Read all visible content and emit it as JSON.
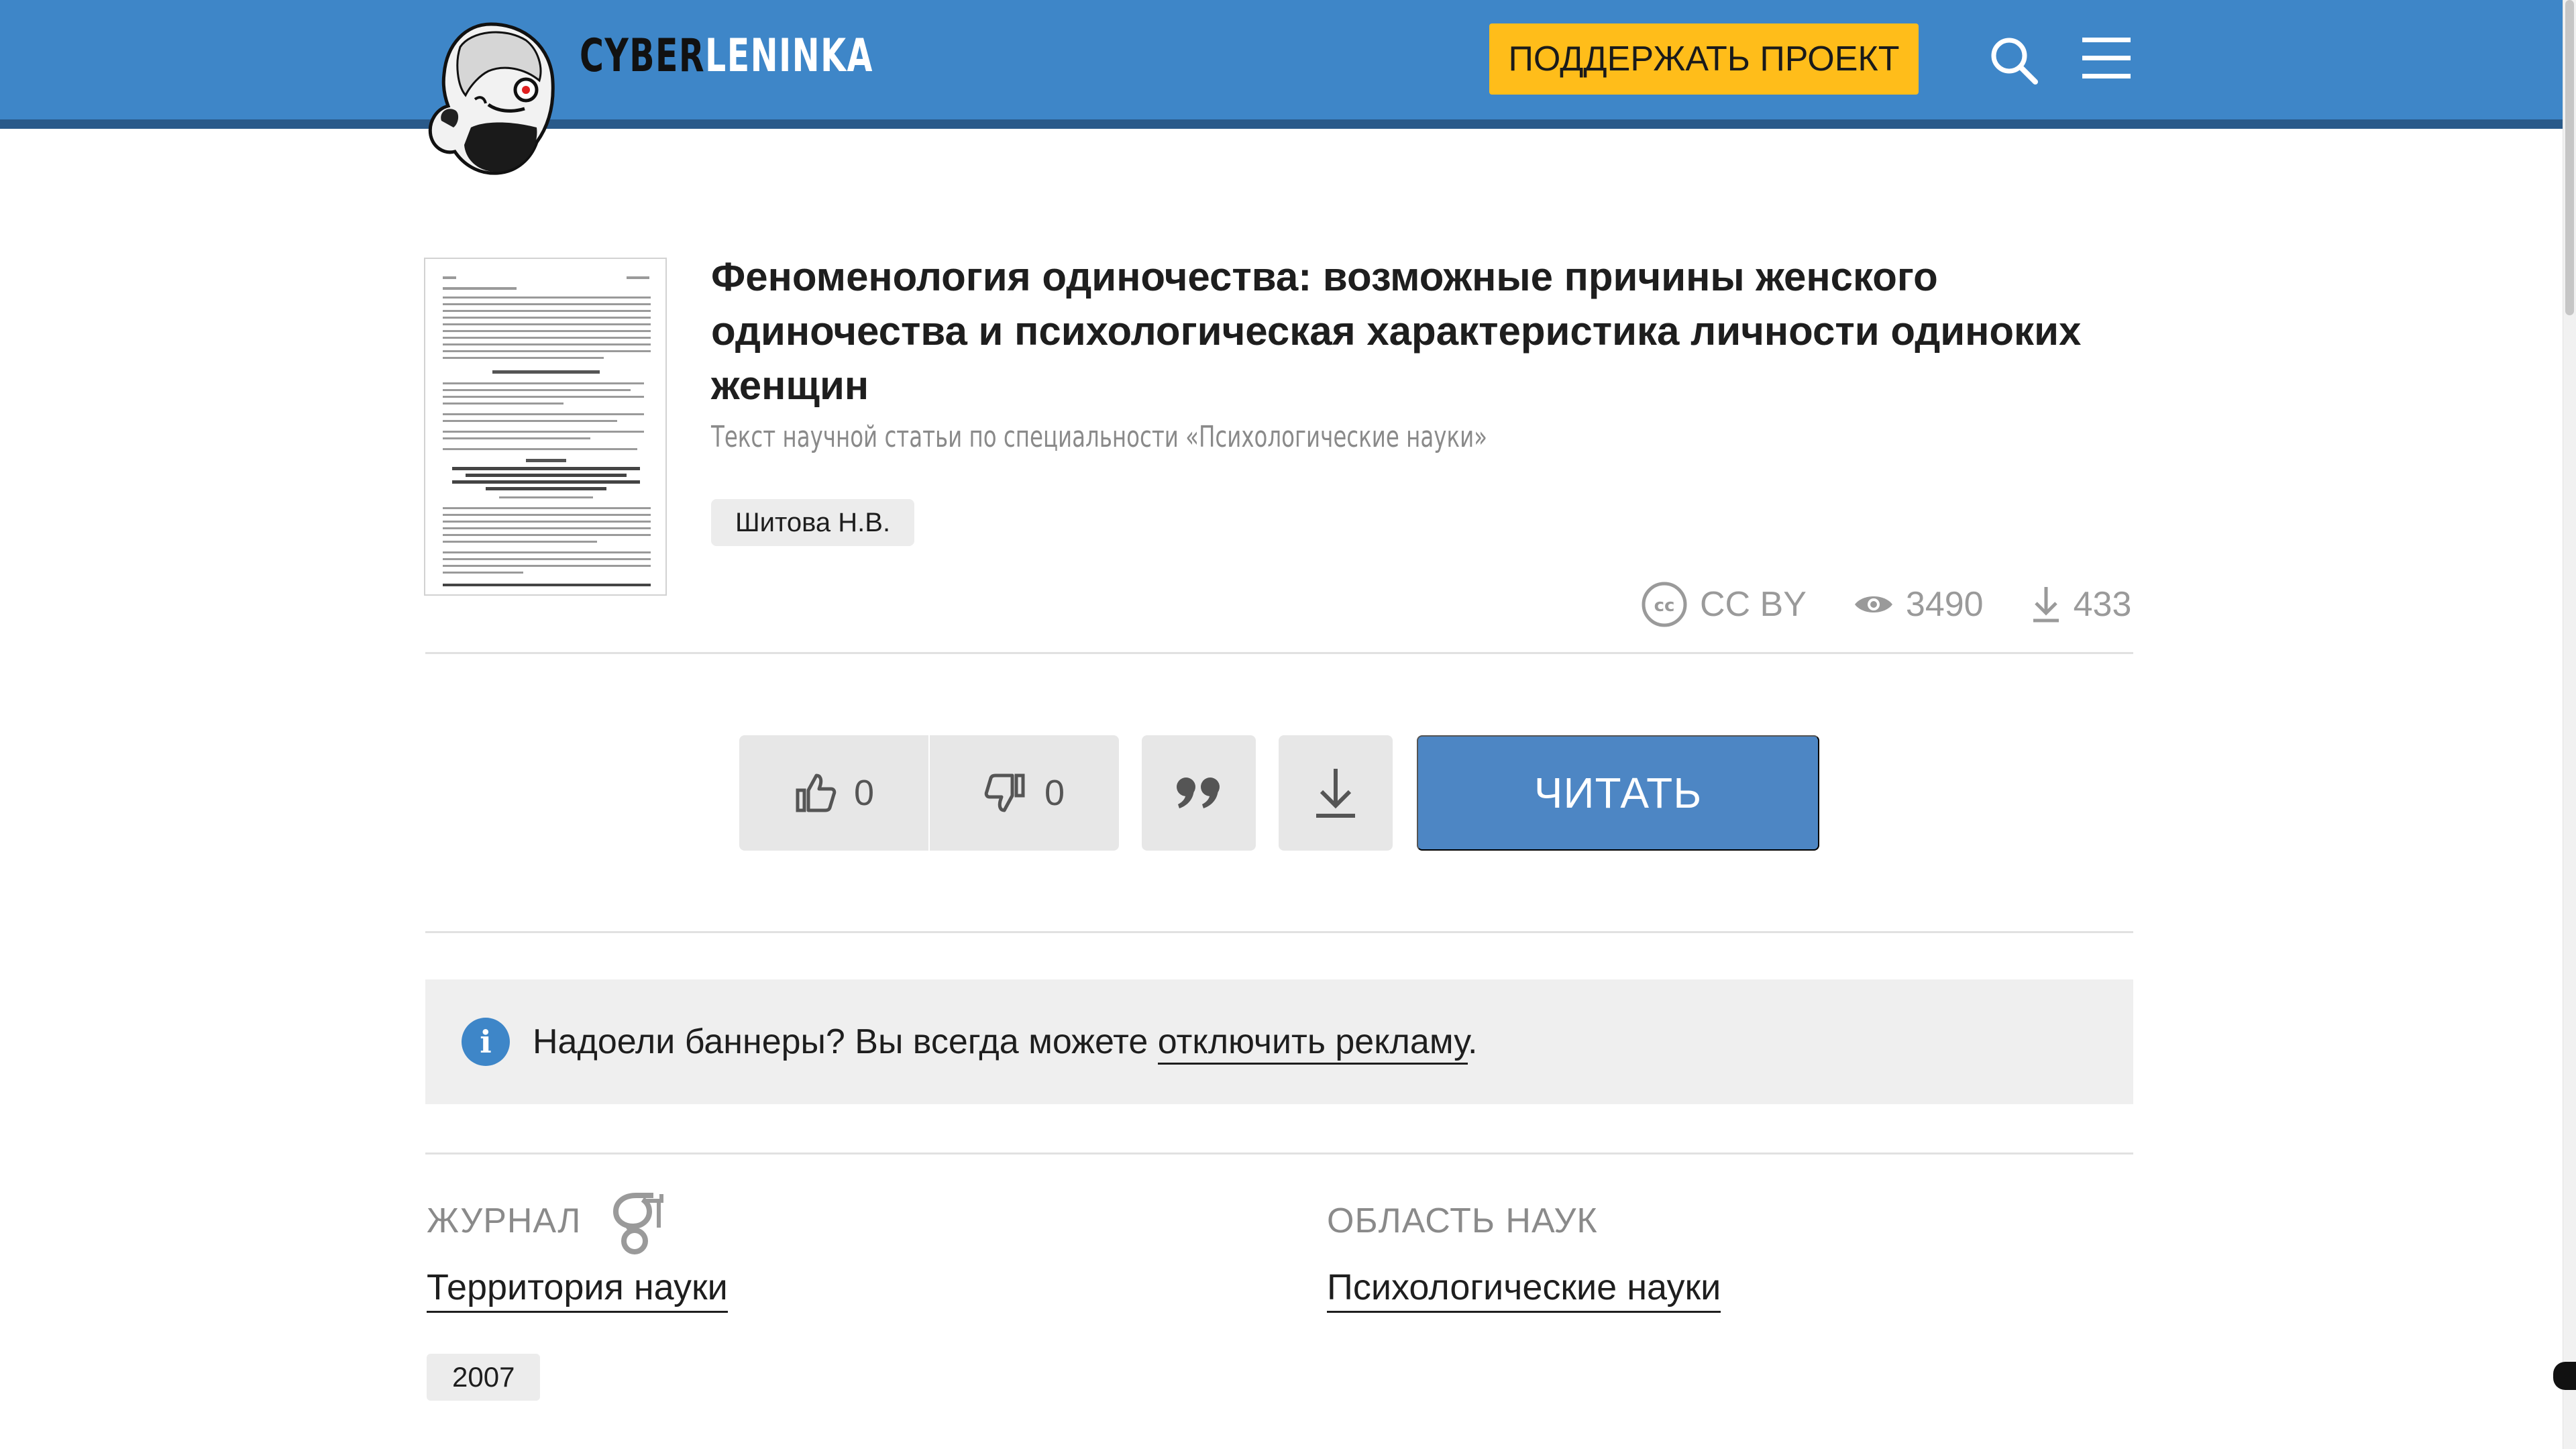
{
  "header": {
    "logo_part1": "CYBER",
    "logo_part2": "LENINKA",
    "support_label": "ПОДДЕРЖАТЬ ПРОЕКТ",
    "accent_color": "#3e86c8",
    "support_color": "#ffbd1a"
  },
  "article": {
    "title": "Феноменология одиночества: возможные причины женского одиночества и психологическая характеристика личности одиноких женщин",
    "subtitle": "Текст научной статьи по специальности «Психологические науки»",
    "author": "Шитова Н.В.",
    "license": "CC BY",
    "views": "3490",
    "downloads": "433"
  },
  "actions": {
    "likes": "0",
    "dislikes": "0",
    "read_label": "ЧИТАТЬ"
  },
  "banner": {
    "text_before": "Надоели баннеры? Вы всегда можете ",
    "link": "отключить рекламу",
    "text_after": "."
  },
  "meta": {
    "journal_label": "ЖУРНАЛ",
    "journal_name": "Территория науки",
    "field_label": "ОБЛАСТЬ НАУК",
    "field_name": "Психологические науки",
    "year": "2007"
  },
  "icons": [
    "logo-head-icon",
    "search-icon",
    "menu-icon",
    "cc-icon",
    "eye-icon",
    "download-icon",
    "thumbs-up-icon",
    "thumbs-down-icon",
    "quote-icon",
    "info-icon",
    "google-scholar-icon"
  ]
}
